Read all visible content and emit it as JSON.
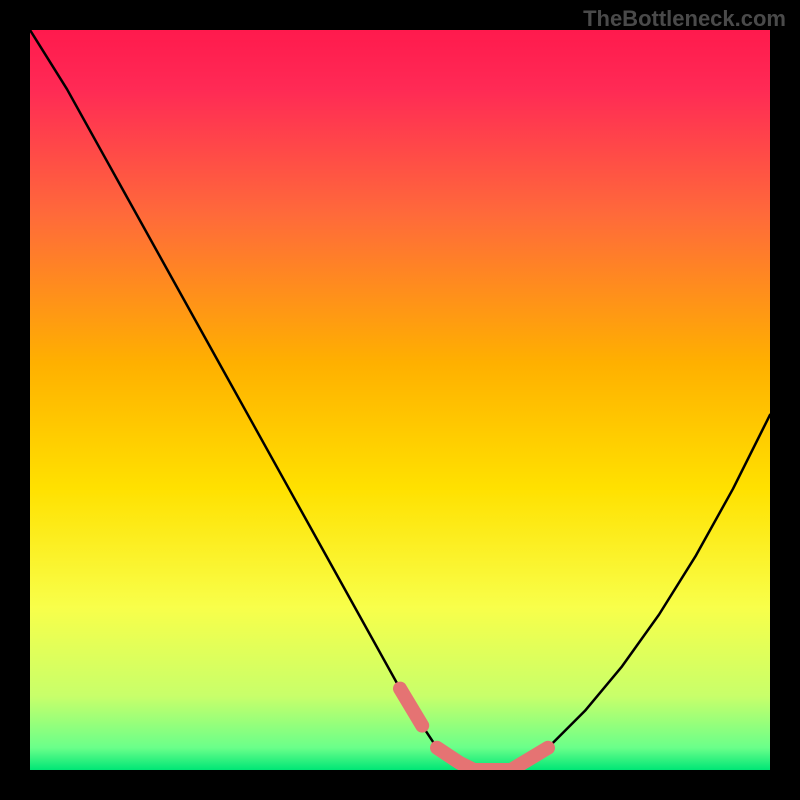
{
  "watermark": "TheBottleneck.com",
  "colors": {
    "background": "#000000",
    "gradient_top": "#ff1a4d",
    "gradient_mid": "#ffd400",
    "gradient_bottom": "#00e676",
    "curve": "#000000",
    "highlight": "#e57373"
  },
  "chart_data": {
    "type": "line",
    "title": "",
    "xlabel": "",
    "ylabel": "",
    "xlim": [
      0,
      100
    ],
    "ylim": [
      0,
      100
    ],
    "x": [
      0,
      5,
      10,
      15,
      20,
      25,
      30,
      35,
      40,
      45,
      50,
      53,
      55,
      58,
      60,
      63,
      65,
      70,
      75,
      80,
      85,
      90,
      95,
      100
    ],
    "values": [
      100,
      92,
      83,
      74,
      65,
      56,
      47,
      38,
      29,
      20,
      11,
      6,
      3,
      1,
      0,
      0,
      0,
      3,
      8,
      14,
      21,
      29,
      38,
      48
    ],
    "highlight_segments": [
      {
        "x": [
          50,
          53
        ],
        "y": [
          11,
          6
        ]
      },
      {
        "x": [
          55,
          58,
          60,
          63,
          65,
          70
        ],
        "y": [
          3,
          1,
          0,
          0,
          0,
          3
        ]
      }
    ],
    "note": "y represents bottleneck percentage; color gradient encodes y (red=high, green=low); no axis ticks or labels are shown"
  }
}
